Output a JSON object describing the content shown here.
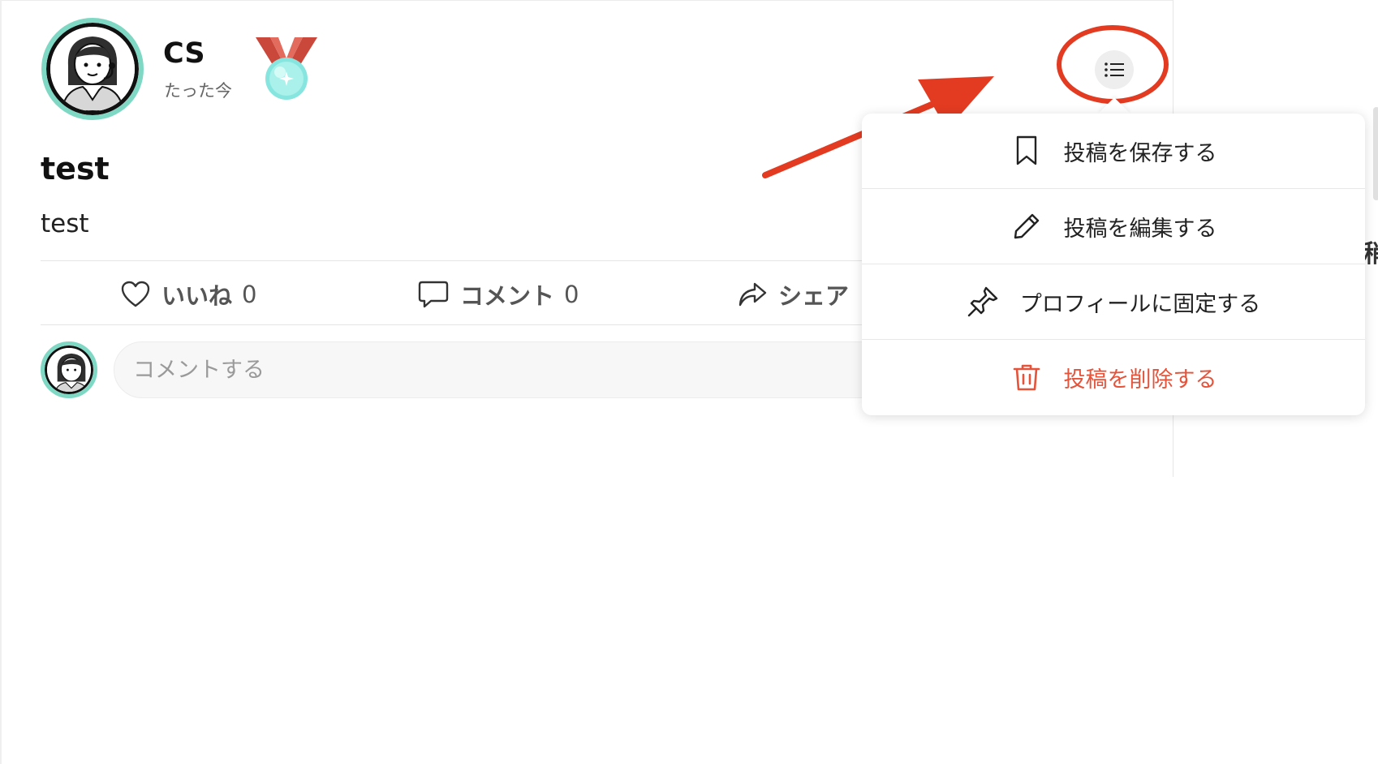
{
  "post": {
    "author": "CS",
    "time": "たった今",
    "title": "test",
    "body": "test"
  },
  "actions": {
    "like_label": "いいね",
    "like_count": "0",
    "comment_label": "コメント",
    "comment_count": "0",
    "share_label": "シェア"
  },
  "comment_box": {
    "placeholder": "コメントする"
  },
  "menu": {
    "items": [
      {
        "label": "投稿を保存する",
        "icon": "bookmark-icon"
      },
      {
        "label": "投稿を編集する",
        "icon": "pencil-icon"
      },
      {
        "label": "プロフィールに固定する",
        "icon": "pin-icon"
      },
      {
        "label": "投稿を削除する",
        "icon": "trash-icon",
        "color": "#e5533a"
      }
    ]
  },
  "colors": {
    "avatar_ring": "#7ed8c4",
    "annotation": "#e23b22",
    "danger": "#e5533a"
  },
  "right_panel": {
    "fragment": "稍"
  }
}
